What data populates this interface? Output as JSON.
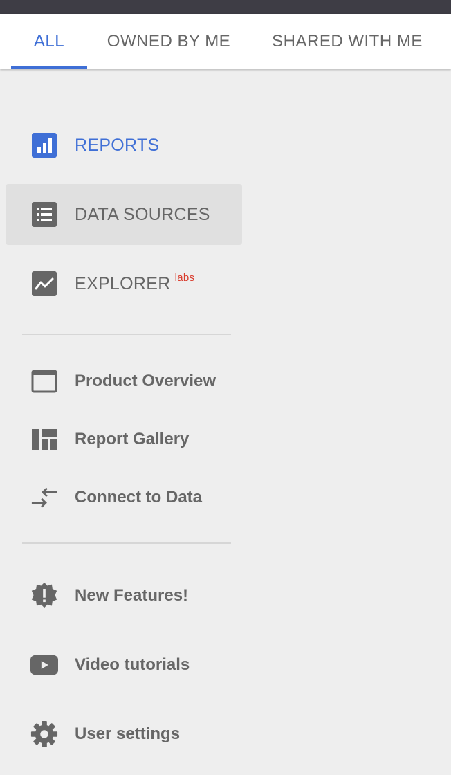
{
  "tabs": [
    {
      "label": "ALL",
      "active": true
    },
    {
      "label": "OWNED BY ME",
      "active": false
    },
    {
      "label": "SHARED WITH ME",
      "active": false
    }
  ],
  "nav": {
    "reports": {
      "label": "REPORTS",
      "icon": "bar-chart-icon"
    },
    "data_sources": {
      "label": "DATA SOURCES",
      "icon": "list-icon",
      "selected": true
    },
    "explorer": {
      "label": "EXPLORER",
      "badge": "labs",
      "icon": "trend-line-icon"
    }
  },
  "links": {
    "product_overview": {
      "label": "Product Overview",
      "icon": "browser-window-icon"
    },
    "report_gallery": {
      "label": "Report Gallery",
      "icon": "dashboard-grid-icon"
    },
    "connect_to_data": {
      "label": "Connect to Data",
      "icon": "connect-arrows-icon"
    },
    "new_features": {
      "label": "New Features!",
      "icon": "new-badge-icon"
    },
    "video_tutorials": {
      "label": "Video tutorials",
      "icon": "youtube-play-icon"
    },
    "user_settings": {
      "label": "User settings",
      "icon": "gear-icon"
    }
  },
  "colors": {
    "accent": "#3f6fd6",
    "text": "#666666",
    "labs": "#d93a2b",
    "topbar": "#3e3d45",
    "background": "#eeeeee"
  }
}
